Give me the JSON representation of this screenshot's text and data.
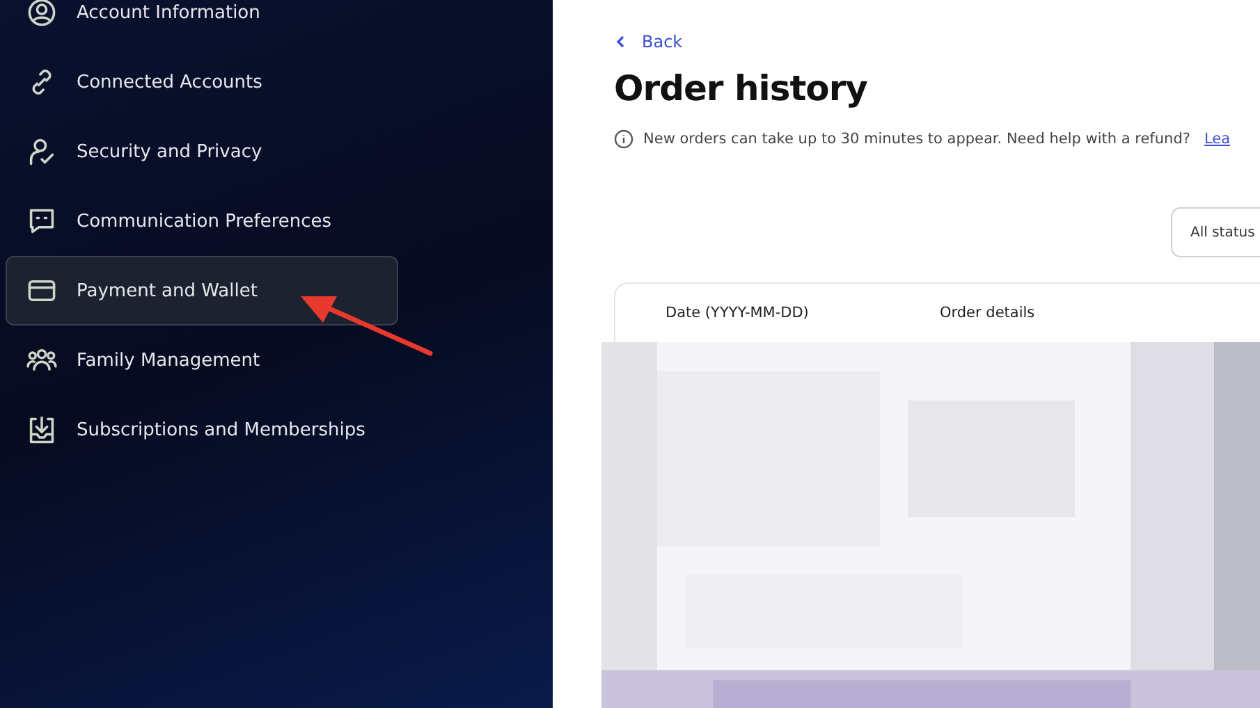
{
  "sidebar": {
    "items": [
      {
        "label": "Account Information",
        "selected": false
      },
      {
        "label": "Connected Accounts",
        "selected": false
      },
      {
        "label": "Security and Privacy",
        "selected": false
      },
      {
        "label": "Communication Preferences",
        "selected": false
      },
      {
        "label": "Payment and Wallet",
        "selected": true
      },
      {
        "label": "Family Management",
        "selected": false
      },
      {
        "label": "Subscriptions and Memberships",
        "selected": false
      }
    ]
  },
  "main": {
    "back": "Back",
    "title": "Order history",
    "notice": "New orders can take up to 30 minutes to appear. Need help with a refund?",
    "notice_link": "Lea",
    "status_filter": "All status",
    "table": {
      "columns": [
        "Date (YYYY-MM-DD)",
        "Order details"
      ]
    }
  }
}
